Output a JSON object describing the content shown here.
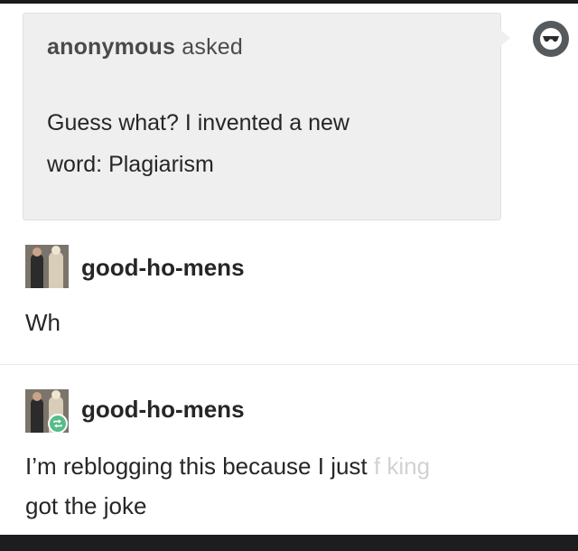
{
  "ask": {
    "asker": "anonymous",
    "asked_label": "asked",
    "question_line1": "Guess what? I invented a new",
    "question_line2": "word: Plagiarism"
  },
  "post1": {
    "username": "good-ho-mens",
    "body": "Wh"
  },
  "post2": {
    "username": "good-ho-mens",
    "body_line1": "I’m reblogging this because I just",
    "body_faded": "f    king",
    "body_line2": "got the joke"
  },
  "icons": {
    "anon_avatar": "sunglasses-icon",
    "reblog": "reblog-icon",
    "reblog_color": "#56bc8a"
  }
}
